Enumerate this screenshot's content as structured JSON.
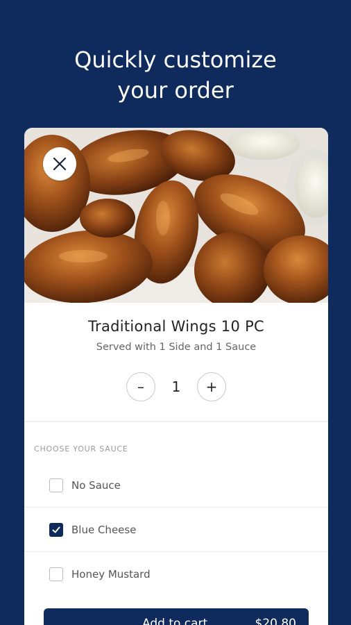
{
  "promo": {
    "headline_line1": "Quickly customize",
    "headline_line2": "your order"
  },
  "item": {
    "title": "Traditional Wings 10 PC",
    "subtitle": "Served with 1 Side and 1 Sauce",
    "close_icon": "close-icon",
    "photo_alt": "chicken wings with dipping sauces"
  },
  "quantity": {
    "minus_label": "–",
    "value": "1",
    "plus_label": "+"
  },
  "sauce_section": {
    "label": "CHOOSE YOUR SAUCE",
    "options": [
      {
        "label": "No Sauce",
        "checked": false
      },
      {
        "label": "Blue Cheese",
        "checked": true
      },
      {
        "label": "Honey Mustard",
        "checked": false
      }
    ]
  },
  "cart": {
    "button_label": "Add to cart",
    "price": "$20.80"
  },
  "colors": {
    "background": "#0f2a5c",
    "accent": "#0f2a5c",
    "card": "#ffffff"
  }
}
